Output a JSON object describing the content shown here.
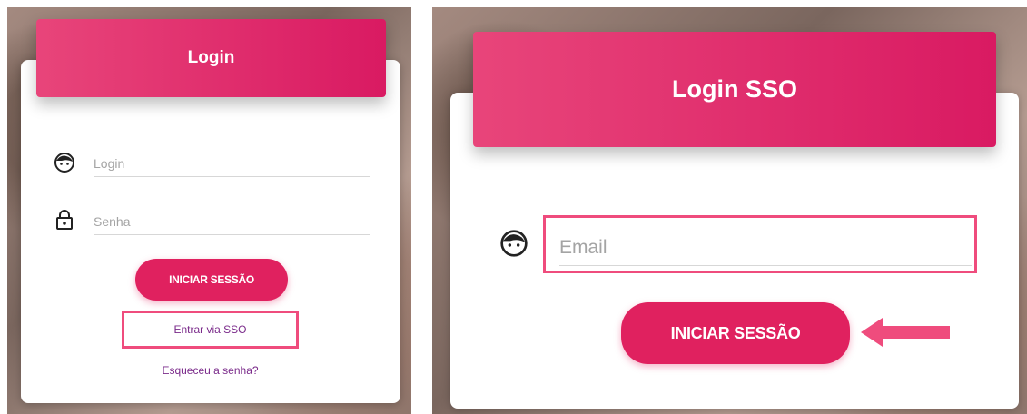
{
  "left_panel": {
    "header_title": "Login",
    "login_placeholder": "Login",
    "password_placeholder": "Senha",
    "submit_label": "INICIAR SESSÃO",
    "sso_link": "Entrar via SSO",
    "forgot_link": "Esqueceu a senha?",
    "icons": {
      "user": "user-face-icon",
      "lock": "lock-icon"
    }
  },
  "right_panel": {
    "header_title": "Login SSO",
    "email_placeholder": "Email",
    "submit_label": "INICIAR SESSÃO",
    "icons": {
      "user": "user-face-icon",
      "arrow": "arrow-left-icon"
    }
  },
  "colors": {
    "accent": "#e0215f",
    "header_gradient_start": "#e8457a",
    "header_gradient_end": "#d91a62",
    "highlight": "#ef4c7d",
    "link": "#7a2a8a"
  }
}
